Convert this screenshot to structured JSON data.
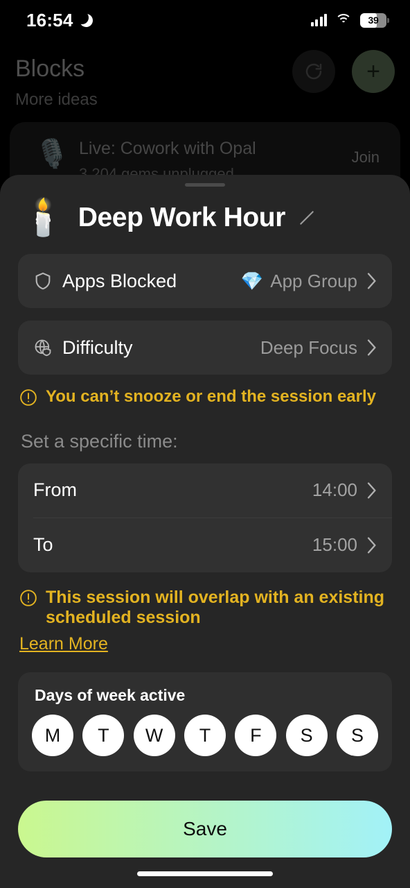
{
  "status_bar": {
    "time": "16:54",
    "dnd_icon": "crescent-moon-icon",
    "signal_icon": "cellular-signal-icon",
    "wifi_icon": "wifi-icon",
    "battery_level": "39"
  },
  "background_app": {
    "title": "Blocks",
    "subtitle": "More ideas",
    "refresh_icon": "refresh-icon",
    "add_label": "+",
    "live_card": {
      "icon": "microphone-icon",
      "title": "Live: Cowork with Opal",
      "subtitle": "3,204 gems unplugged",
      "join_label": "Join"
    }
  },
  "sheet": {
    "header": {
      "emoji": "🕯️",
      "title": "Deep Work Hour",
      "edit_icon": "pencil-edit-icon"
    },
    "settings": [
      {
        "icon": "shield-icon",
        "label": "Apps Blocked",
        "value": "App Group",
        "value_emoji": "💎",
        "chevron": "chevron-right-icon"
      },
      {
        "icon": "globe-shield-icon",
        "label": "Difficulty",
        "value": "Deep Focus",
        "value_emoji": "",
        "chevron": "chevron-right-icon"
      }
    ],
    "warning_one": {
      "icon": "exclamation-circle-icon",
      "text": "You can’t snooze or end the session early"
    },
    "time_section": {
      "label": "Set a specific time:",
      "from": {
        "label": "From",
        "value": "14:00"
      },
      "to": {
        "label": "To",
        "value": "15:00"
      }
    },
    "warning_two": {
      "icon": "exclamation-circle-icon",
      "text": "This session will overlap with an existing scheduled session",
      "link_label": "Learn More"
    },
    "days": {
      "title": "Days of week active",
      "items": [
        {
          "letter": "M",
          "active": true
        },
        {
          "letter": "T",
          "active": true
        },
        {
          "letter": "W",
          "active": true
        },
        {
          "letter": "T",
          "active": true
        },
        {
          "letter": "F",
          "active": true
        },
        {
          "letter": "S",
          "active": true
        },
        {
          "letter": "S",
          "active": true
        }
      ]
    },
    "save_label": "Save"
  },
  "colors": {
    "sheet_bg": "#262626",
    "card_bg": "#313131",
    "warning": "#e3b321",
    "save_gradient_start": "#caf78f",
    "save_gradient_end": "#a2f2f8",
    "accent_green": "#2c3629"
  },
  "home_indicator": "home-indicator"
}
